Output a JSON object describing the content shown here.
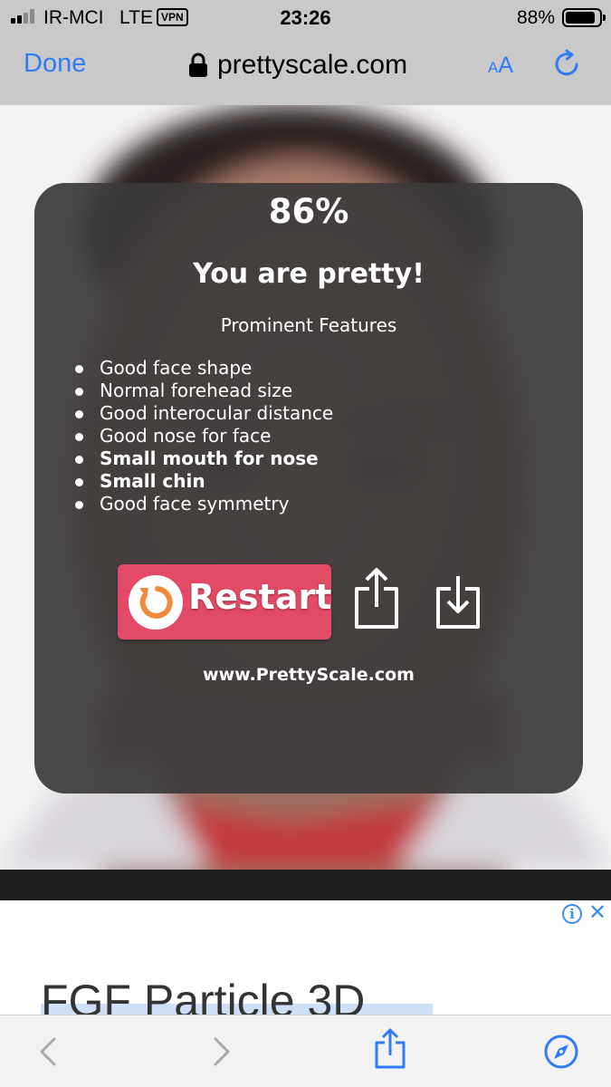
{
  "status_bar": {
    "carrier": "IR-MCI",
    "network": "LTE",
    "vpn_badge": "VPN",
    "time": "23:26",
    "battery_percent": "88%",
    "battery_level": 0.88
  },
  "nav_bar": {
    "done_label": "Done",
    "url": "prettyscale.com",
    "text_size_small": "A",
    "text_size_big": "A",
    "accent_color": "#2f7cf6"
  },
  "result": {
    "score": "86%",
    "verdict": "You are pretty!",
    "features_title": "Prominent Features",
    "features": [
      {
        "text": "Good face shape",
        "bold": false
      },
      {
        "text": "Normal forehead size",
        "bold": false
      },
      {
        "text": "Good interocular distance",
        "bold": false
      },
      {
        "text": "Good nose for face",
        "bold": false
      },
      {
        "text": "Small mouth for nose",
        "bold": true
      },
      {
        "text": "Small chin",
        "bold": true
      },
      {
        "text": "Good face symmetry",
        "bold": false
      }
    ],
    "restart_label": "Restart",
    "restart_color": "#e24a66",
    "site_link": "www.PrettyScale.com"
  },
  "ad": {
    "title": "FGF Particle 3D",
    "info_icon": "i"
  },
  "icons": {
    "signal": "signal-icon",
    "lock": "lock-icon",
    "reload": "reload-icon",
    "restart": "restart-icon",
    "share": "share-icon",
    "download": "download-icon",
    "back": "back-arrow-icon",
    "forward": "forward-arrow-icon",
    "compass": "compass-icon",
    "close": "close-icon"
  }
}
